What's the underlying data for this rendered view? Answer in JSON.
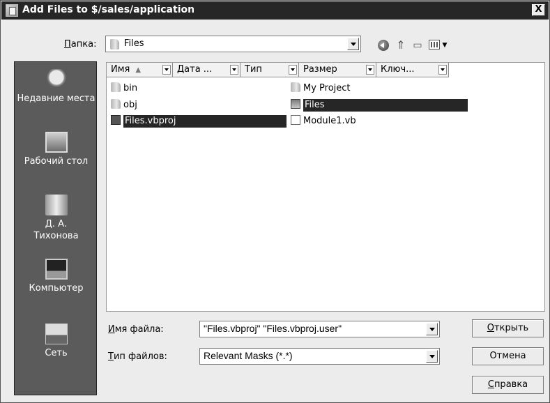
{
  "window": {
    "title": "Add Files to $/sales/application",
    "close_label": "X"
  },
  "look_in": {
    "label_prefix": "",
    "label_accel": "П",
    "label_rest": "апка:",
    "value": "Files"
  },
  "toolbar": {
    "icons": [
      "back-icon",
      "up-folder-icon",
      "new-folder-icon",
      "views-menu-icon"
    ]
  },
  "places": [
    {
      "label": "Недавние места",
      "icon": "recent-places-icon"
    },
    {
      "label": "Рабочий стол",
      "icon": "desktop-icon"
    },
    {
      "label": "Д. А. Тихонова",
      "icon": "user-documents-icon"
    },
    {
      "label": "Компьютер",
      "icon": "computer-icon"
    },
    {
      "label": "Сеть",
      "icon": "network-icon"
    }
  ],
  "columns": [
    {
      "label": "Имя",
      "sort": "▲"
    },
    {
      "label": "Дата ..."
    },
    {
      "label": "Тип"
    },
    {
      "label": "Размер"
    },
    {
      "label": "Ключ..."
    }
  ],
  "files": [
    {
      "name": "bin",
      "type": "folder",
      "selected": false
    },
    {
      "name": "obj",
      "type": "folder",
      "selected": false
    },
    {
      "name": "Files.vbproj",
      "type": "vbproj",
      "selected": true
    },
    {
      "name": "My Project",
      "type": "folder",
      "selected": false
    },
    {
      "name": "Files",
      "type": "project",
      "selected": true
    },
    {
      "name": "Module1.vb",
      "type": "vbfile",
      "selected": false
    }
  ],
  "filename": {
    "label_accel": "И",
    "label_rest": "мя файла:",
    "value": "\"Files.vbproj\" \"Files.vbproj.user\""
  },
  "filetype": {
    "label_accel": "Т",
    "label_rest": "ип файлов:",
    "value": "Relevant Masks (*.*)"
  },
  "buttons": {
    "open_accel": "О",
    "open_rest": "ткрыть",
    "cancel": "Отмена",
    "help_accel": "С",
    "help_rest": "правка"
  },
  "colors": {
    "titlebar": "#262626",
    "places_panel": "#5b5b5b",
    "selection": "#262626",
    "dialog_bg": "#ececec"
  }
}
